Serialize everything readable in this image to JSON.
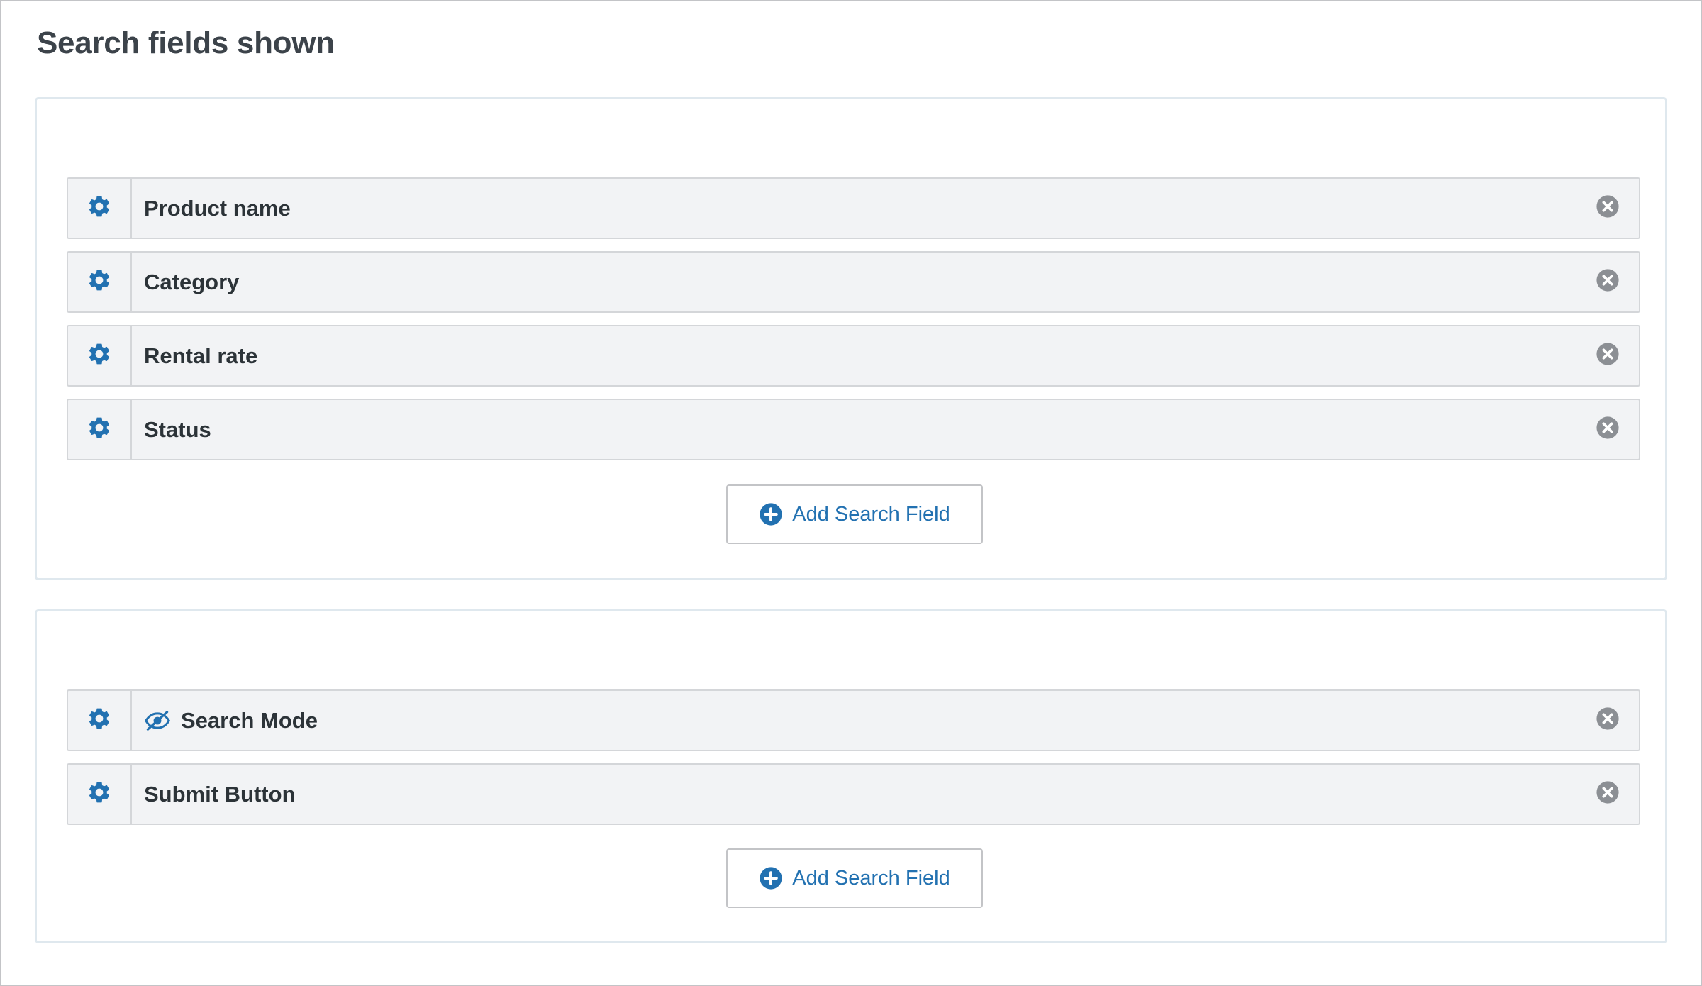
{
  "page": {
    "title": "Search fields shown"
  },
  "sections": [
    {
      "fields": [
        {
          "label": "Product name",
          "hidden": false
        },
        {
          "label": "Category",
          "hidden": false
        },
        {
          "label": "Rental rate",
          "hidden": false
        },
        {
          "label": "Status",
          "hidden": false
        }
      ],
      "add_button_label": "Add Search Field"
    },
    {
      "fields": [
        {
          "label": "Search Mode",
          "hidden": true
        },
        {
          "label": "Submit Button",
          "hidden": false
        }
      ],
      "add_button_label": "Add Search Field"
    }
  ],
  "icons": {
    "settings": "gear-icon",
    "remove": "close-circle-icon",
    "add": "plus-circle-icon",
    "hidden": "eye-slash-icon"
  },
  "colors": {
    "accent": "#2271b1",
    "remove_icon": "#8c8f94",
    "row_background": "#f2f3f5",
    "title_text": "#3c434a"
  }
}
